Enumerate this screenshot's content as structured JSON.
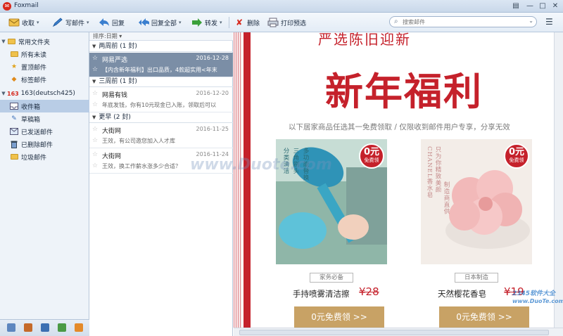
{
  "window": {
    "title": "Foxmail"
  },
  "toolbar": {
    "receive": "收取",
    "compose": "写邮件",
    "reply": "回复",
    "reply_all": "回复全部",
    "forward": "转发",
    "delete": "删除",
    "print_preview": "打印预选"
  },
  "search": {
    "placeholder": "搜索邮件"
  },
  "sidebar": {
    "common_folder": "常用文件夹",
    "all_unread": "所有未读",
    "pinned": "置顶邮件",
    "tagged": "标签邮件",
    "account": "163(deutsch425)",
    "account_badge": "163",
    "inbox": "收件箱",
    "drafts": "草稿箱",
    "sent": "已发送邮件",
    "deleted": "已删除邮件",
    "spam": "垃圾邮件"
  },
  "maillist": {
    "sort_label": "排序:日期",
    "groups": [
      {
        "label": "两周前 (1 封)"
      },
      {
        "label": "三周前 (1 封)"
      },
      {
        "label": "更早 (2 封)"
      }
    ],
    "mails": [
      {
        "sender": "网易严选",
        "date": "2016-12-28",
        "subject": "【内含新年福利】出口品质，4款超实用<年末"
      },
      {
        "sender": "网易有钱",
        "date": "2016-12-20",
        "subject": "年底发钱，你有10元现金已入账，领取后可以"
      },
      {
        "sender": "大街网",
        "date": "2016-11-25",
        "subject": "王效，有公司邀您加入人才库"
      },
      {
        "sender": "大街网",
        "date": "2016-11-24",
        "subject": "王效，换工作薪水涨多少合适？"
      }
    ]
  },
  "preview": {
    "top_banner": "严选陈旧迎新",
    "title": "新年福利",
    "subline": "以下居家商品任选其一免费领取 / 仅限收到邮件用户专享，分享无效",
    "cards": [
      {
        "badge_main": "0元",
        "badge_sub": "免费领",
        "tag": "家务必备",
        "name": "手持喷雾清洁擦",
        "old_price": "¥28",
        "cta": "0元免费领 >>",
        "vertical_text_1": "分类清洁",
        "vertical_text_2": "三角刷头",
        "vertical_text_3": "多功能替换"
      },
      {
        "badge_main": "0元",
        "badge_sub": "免费领",
        "tag": "日本制造",
        "name": "天然樱花香皂",
        "old_price": "¥19",
        "cta": "0元免费领 >>",
        "vertical_text_1": "CHANEL香水皂",
        "vertical_text_2": "只为你精致美颜",
        "vertical_text_3": "制造商直供"
      }
    ]
  },
  "watermarks": {
    "center": "www.Duote.com",
    "corner1": "2345软件大全",
    "corner2": "www.DuoTe.com"
  },
  "colors": {
    "brand_red": "#c5212b",
    "cta_gold": "#c8a265",
    "selected_row": "#7b8ea6",
    "sidebar_bg": "#eef3f9"
  }
}
